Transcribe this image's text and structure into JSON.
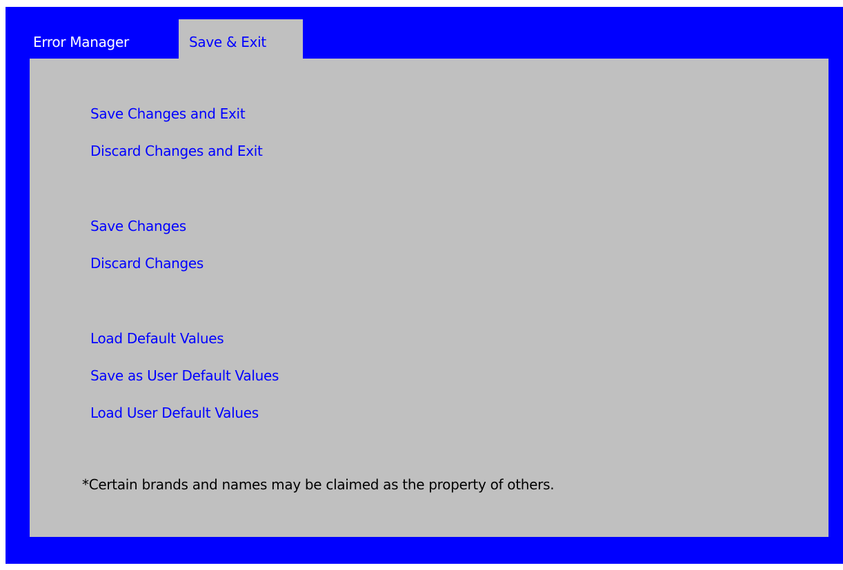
{
  "colors": {
    "background": "#0000ff",
    "panel": "#c0c0c0",
    "active_tab_text": "#0000ff",
    "inactive_tab_text": "#ffffff",
    "menu_text": "#0000ff",
    "footnote_text": "#000000"
  },
  "tabs": [
    {
      "label": "Error Manager",
      "active": false
    },
    {
      "label": "Save & Exit",
      "active": true
    }
  ],
  "menu": {
    "items": [
      {
        "label": "Save Changes and Exit"
      },
      {
        "label": "Discard Changes and Exit"
      },
      {
        "label": "Save Changes"
      },
      {
        "label": "Discard Changes"
      },
      {
        "label": "Load Default Values"
      },
      {
        "label": "Save as User Default Values"
      },
      {
        "label": "Load User Default Values"
      }
    ]
  },
  "footnote": "*Certain brands and names may be claimed as the property of others."
}
